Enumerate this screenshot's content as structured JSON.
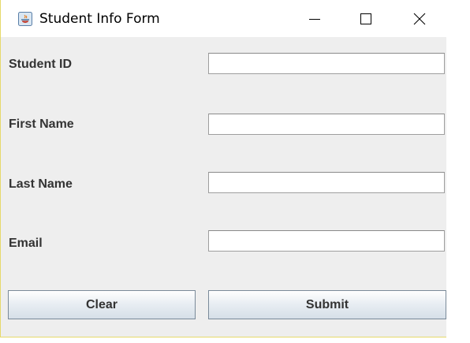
{
  "window": {
    "title": "Student Info Form",
    "border_color": "#e6d96a",
    "background": "#eeeeee"
  },
  "titlebar_controls": [
    "minimize-icon",
    "maximize-icon",
    "close-icon"
  ],
  "form": {
    "fields": [
      {
        "label": "Student ID",
        "value": "",
        "placeholder": ""
      },
      {
        "label": "First Name",
        "value": "",
        "placeholder": ""
      },
      {
        "label": "Last Name",
        "value": "",
        "placeholder": ""
      },
      {
        "label": "Email",
        "value": "",
        "placeholder": ""
      }
    ],
    "buttons": {
      "clear_label": "Clear",
      "submit_label": "Submit"
    }
  }
}
